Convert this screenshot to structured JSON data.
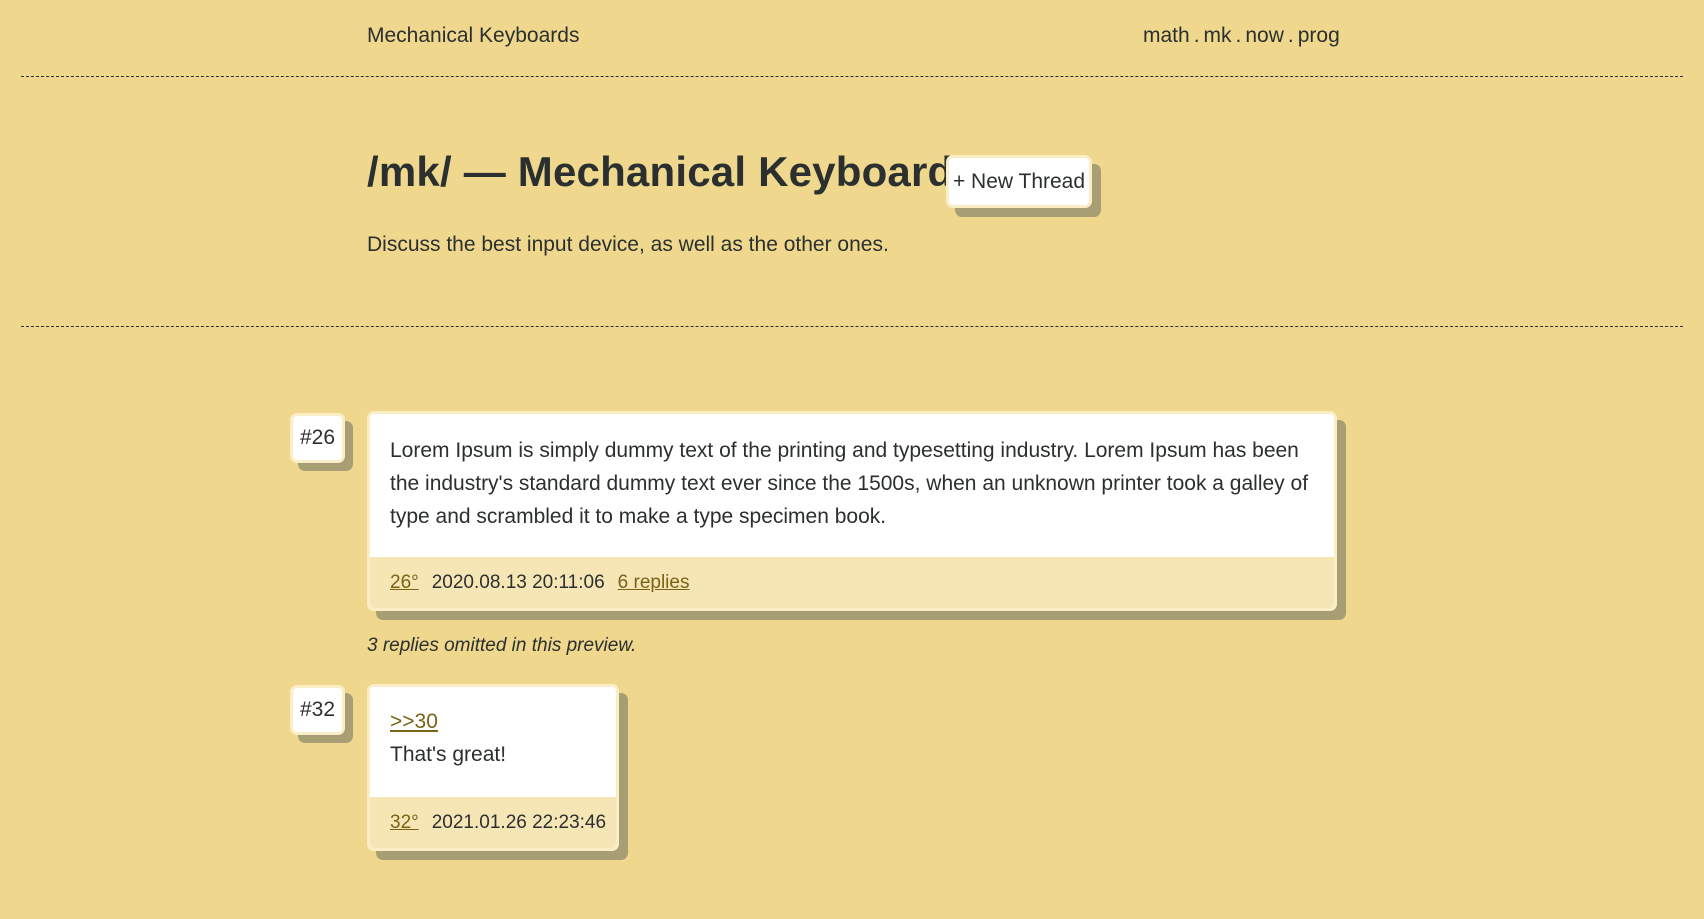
{
  "header": {
    "site_title": "Mechanical Keyboards",
    "boards": [
      "math",
      "mk",
      "now",
      "prog"
    ],
    "separator": "."
  },
  "board": {
    "heading": "/mk/ — Mechanical Keyboards",
    "new_thread_label": "+ New Thread",
    "description": "Discuss the best input device, as well as the other ones."
  },
  "posts": [
    {
      "number_label": "#26",
      "body": "Lorem Ipsum is simply dummy text of the printing and typesetting industry. Lorem Ipsum has been the industry's standard dummy text ever since the 1500s, when an unknown printer took a galley of type and scrambled it to make a type specimen book.",
      "degree_link": "26°",
      "timestamp": "2020.08.13 20:11:06",
      "replies_link": "6 replies"
    },
    {
      "number_label": "#32",
      "quote_link": ">>30",
      "body": "That's great!",
      "degree_link": "32°",
      "timestamp": "2021.01.26 22:23:46"
    }
  ],
  "omitted_notice": "3 replies omitted in this preview.",
  "colors": {
    "background": "#efd88d",
    "card": "#ffffff",
    "card_border": "#fbeec6",
    "footer": "#f6e6b6",
    "shadow": "#a89e73",
    "text": "#2b2f2f",
    "link": "#7a6316"
  }
}
